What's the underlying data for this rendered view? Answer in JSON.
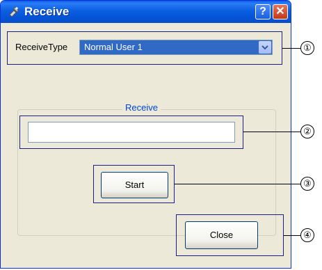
{
  "window": {
    "title": "Receive",
    "help_label": "?",
    "close_label": "✕"
  },
  "receive_type": {
    "label": "ReceiveType",
    "selected": "Normal User 1"
  },
  "receive_group": {
    "title": "Receive",
    "field_value": ""
  },
  "buttons": {
    "start_label": "Start",
    "close_label": "Close"
  },
  "callouts": [
    "①",
    "②",
    "③",
    "④"
  ],
  "colors": {
    "titlebar": "#0a5fe0",
    "selection": "#316ac5",
    "callout_frame": "#1d1d8a"
  },
  "icons": {
    "title": "satellite-icon",
    "dropdown": "chevron-down-icon"
  }
}
